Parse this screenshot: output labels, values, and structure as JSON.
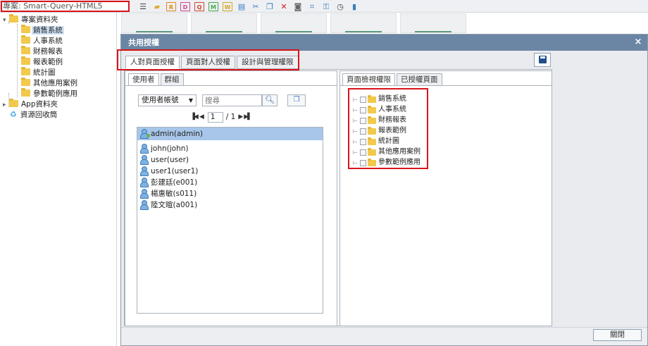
{
  "toolbar": {
    "project_label": "專案: Smart-Query-HTML5",
    "icons": [
      "menu-icon",
      "folder-add-icon",
      "report-icon",
      "chart-d-icon",
      "doc-q-icon",
      "doc-m-icon",
      "doc-w-icon",
      "list-icon",
      "scissors-icon",
      "copy-icon",
      "delete-icon",
      "camera-icon",
      "frame-icon",
      "key-icon",
      "clock-icon",
      "book-icon"
    ]
  },
  "tree": {
    "root": "專案資料夾",
    "children": [
      "銷售系統",
      "人事系統",
      "財務報表",
      "報表範例",
      "統計圖",
      "其他應用案例",
      "參數範例應用"
    ],
    "app_folder": "App資料夾",
    "recycle": "資源回收筒"
  },
  "dialog": {
    "title": "共用授權",
    "close": "×",
    "tabs": [
      "人對頁面授權",
      "頁面對人授權",
      "設計與管理權限"
    ],
    "left_tabs": [
      "使用者",
      "群組"
    ],
    "select_value": "使用者帳號",
    "search_placeholder": "搜尋",
    "pager": {
      "page": "1",
      "of_label": "/ 1"
    },
    "users": [
      "admin(admin)",
      "john(john)",
      "user(user)",
      "user1(user1)",
      "彭建廷(e001)",
      "楊惠敏(s011)",
      "陸文暄(a001)"
    ],
    "right_tabs": [
      "頁面檢視權限",
      "已授權頁面"
    ],
    "pages": [
      "銷售系統",
      "人事系統",
      "財務報表",
      "報表範例",
      "統計圖",
      "其他應用案例",
      "參數範例應用"
    ],
    "close_button": "關閉"
  }
}
